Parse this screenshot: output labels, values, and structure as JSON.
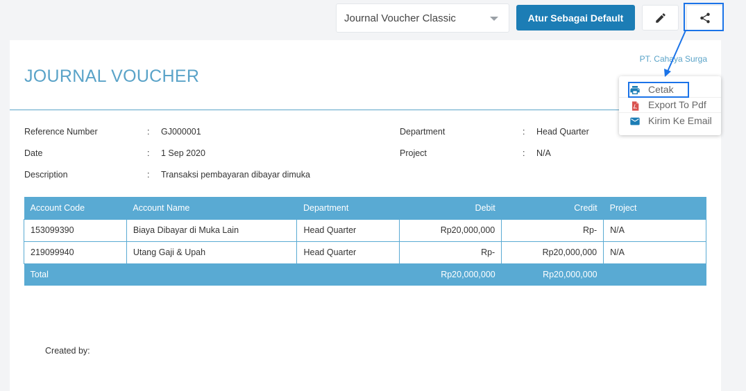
{
  "toolbar": {
    "template_value": "Journal Voucher Classic",
    "set_default_label": "Atur Sebagai Default",
    "edit_icon": "pencil-icon",
    "share_icon": "share-icon"
  },
  "document": {
    "title": "JOURNAL VOUCHER",
    "company_name": "PT. Cahaya Surga",
    "fields": {
      "reference_number": {
        "label": "Reference Number",
        "value": "GJ000001"
      },
      "date": {
        "label": "Date",
        "value": "1 Sep 2020"
      },
      "description": {
        "label": "Description",
        "value": "Transaksi pembayaran dibayar dimuka"
      },
      "department": {
        "label": "Department",
        "value": "Head Quarter"
      },
      "project": {
        "label": "Project",
        "value": "N/A"
      }
    },
    "colon": ":",
    "table": {
      "headers": [
        "Account Code",
        "Account Name",
        "Department",
        "Debit",
        "Credit",
        "Project"
      ],
      "rows": [
        [
          "153099390",
          "Biaya Dibayar di Muka Lain",
          "Head Quarter",
          "Rp20,000,000",
          "Rp-",
          "N/A"
        ],
        [
          "219099940",
          "Utang Gaji & Upah",
          "Head Quarter",
          "Rp-",
          "Rp20,000,000",
          "N/A"
        ]
      ],
      "total": {
        "label": "Total",
        "debit": "Rp20,000,000",
        "credit": "Rp20,000,000"
      }
    },
    "created_by_label": "Created by:"
  },
  "share_menu": {
    "items": [
      {
        "label": "Cetak",
        "icon": "printer-icon"
      },
      {
        "label": "Export To Pdf",
        "icon": "pdf-icon"
      },
      {
        "label": "Kirim Ke Email",
        "icon": "email-icon"
      }
    ]
  },
  "colors": {
    "primary_button": "#1c7db5",
    "table_header": "#59aad3",
    "title": "#5aa3c8",
    "annotation": "#1a73e8"
  }
}
